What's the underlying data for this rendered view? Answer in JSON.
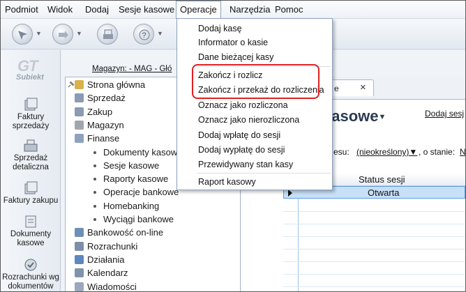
{
  "menubar": {
    "items": [
      "Podmiot",
      "Widok",
      "Dodaj",
      "Sesje kasowe",
      "Operacje",
      "Narzędzia",
      "Pomoc"
    ],
    "active": "Operacje"
  },
  "dropdown": {
    "items": [
      "Dodaj kasę",
      "Informator o kasie",
      "Dane bieżącej kasy",
      "Zakończ i rozlicz",
      "Zakończ i przekaż do rozliczenia",
      "Oznacz jako rozliczona",
      "Oznacz jako nierozliczona",
      "Dodaj wpłatę do sesji",
      "Dodaj wypłatę do sesji",
      "Przewidywany stan kasy",
      "Raport kasowy"
    ]
  },
  "rail": {
    "logo_gt": "GT",
    "logo_text": "Subiekt",
    "items": [
      [
        "Faktury",
        "sprzedaży"
      ],
      [
        "Sprzedaż",
        "detaliczna"
      ],
      [
        "Faktury zakupu"
      ],
      [
        "Dokumenty",
        "kasowe"
      ],
      [
        "Rozrachunki wg",
        "dokumentów"
      ]
    ]
  },
  "content": {
    "magazyn": "Magazyn: - MAG - Głó"
  },
  "tree": {
    "items": [
      {
        "label": "Strona główna",
        "level": 0,
        "icon_color": "#d9b24a"
      },
      {
        "label": "Sprzedaż",
        "level": 0,
        "icon_color": "#8a9bb3"
      },
      {
        "label": "Zakup",
        "level": 0,
        "icon_color": "#8a9bb3"
      },
      {
        "label": "Magazyn",
        "level": 0,
        "icon_color": "#a0a6ad"
      },
      {
        "label": "Finanse",
        "level": 0,
        "icon_color": "#8fa2bd"
      },
      {
        "label": "Dokumenty kasowe",
        "level": 1
      },
      {
        "label": "Sesje kasowe",
        "level": 1
      },
      {
        "label": "Raporty kasowe",
        "level": 1
      },
      {
        "label": "Operacje bankowe",
        "level": 1
      },
      {
        "label": "Homebanking",
        "level": 1
      },
      {
        "label": "Wyciągi bankowe",
        "level": 1
      },
      {
        "label": "Bankowość on-line",
        "level": 0,
        "icon_color": "#6f8fb8"
      },
      {
        "label": "Rozrachunki",
        "level": 0,
        "icon_color": "#7d8fa8"
      },
      {
        "label": "Działania",
        "level": 0,
        "icon_color": "#5f86c0"
      },
      {
        "label": "Kalendarz",
        "level": 0,
        "icon_color": "#7f93ad"
      },
      {
        "label": "Wiadomości",
        "level": 0,
        "icon_color": "#9aa8bc"
      }
    ]
  },
  "panel": {
    "tab_label": "e",
    "tab_close": "×",
    "title": "kasowe",
    "dodaj_link": "Dodaj sesj",
    "filter_label": "esu:",
    "filter_value": "(nieokreślony)",
    "filter_stan": ", o stanie:",
    "filter_end": "N",
    "col_header": "Status sesji",
    "row_value": "Otwarta"
  }
}
